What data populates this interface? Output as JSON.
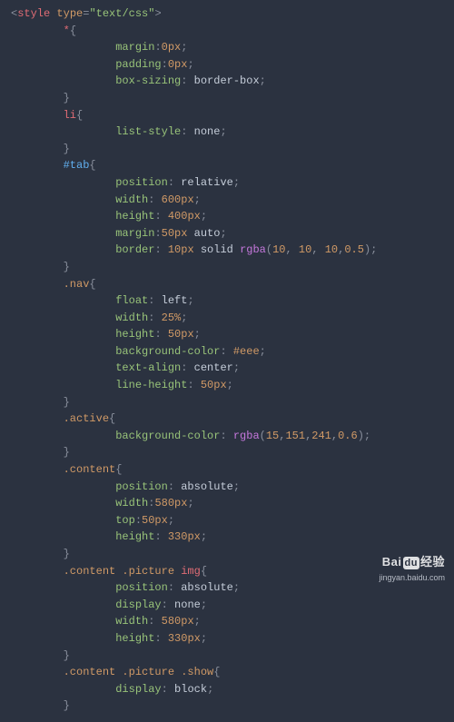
{
  "opening_tag": {
    "lt": "<",
    "name": "style",
    "sp": " ",
    "attr": "type",
    "eq": "=",
    "q1": "\"",
    "val": "text/css",
    "q2": "\"",
    "gt": ">"
  },
  "rules": [
    {
      "indent": "        ",
      "selector": {
        "text": "*",
        "cls": "sel-univ"
      },
      "brace_indent": "        ",
      "prop_indent": "                ",
      "decls": [
        {
          "prop": "margin",
          "sep": ":",
          "parts": [
            {
              "t": "0px",
              "c": "num"
            }
          ]
        },
        {
          "prop": "padding",
          "sep": ":",
          "parts": [
            {
              "t": "0px",
              "c": "num"
            }
          ]
        },
        {
          "prop": "box-sizing",
          "sep": ": ",
          "parts": [
            {
              "t": "border-box",
              "c": "val"
            }
          ]
        }
      ]
    },
    {
      "indent": "        ",
      "selector": {
        "text": "li",
        "cls": "sel-el"
      },
      "brace_indent": "        ",
      "prop_indent": "                ",
      "decls": [
        {
          "prop": "list-style",
          "sep": ": ",
          "parts": [
            {
              "t": "none",
              "c": "val"
            }
          ]
        }
      ]
    },
    {
      "indent": "        ",
      "selector": {
        "text": "#tab",
        "cls": "sel-id"
      },
      "brace_indent": "        ",
      "prop_indent": "                ",
      "decls": [
        {
          "prop": "position",
          "sep": ": ",
          "parts": [
            {
              "t": "relative",
              "c": "val"
            }
          ]
        },
        {
          "prop": "width",
          "sep": ": ",
          "parts": [
            {
              "t": "600px",
              "c": "num"
            }
          ]
        },
        {
          "prop": "height",
          "sep": ": ",
          "parts": [
            {
              "t": "400px",
              "c": "num"
            }
          ]
        },
        {
          "prop": "margin",
          "sep": ":",
          "parts": [
            {
              "t": "50px",
              "c": "num"
            },
            {
              "t": " ",
              "c": "pn"
            },
            {
              "t": "auto",
              "c": "val"
            }
          ]
        },
        {
          "prop": "border",
          "sep": ": ",
          "parts": [
            {
              "t": "10px",
              "c": "num"
            },
            {
              "t": " ",
              "c": "pn"
            },
            {
              "t": "solid",
              "c": "val"
            },
            {
              "t": " ",
              "c": "pn"
            },
            {
              "t": "rgba",
              "c": "fn"
            },
            {
              "t": "(",
              "c": "pn"
            },
            {
              "t": "10",
              "c": "num"
            },
            {
              "t": ", ",
              "c": "pn"
            },
            {
              "t": "10",
              "c": "num"
            },
            {
              "t": ", ",
              "c": "pn"
            },
            {
              "t": "10",
              "c": "num"
            },
            {
              "t": ",",
              "c": "pn"
            },
            {
              "t": "0.5",
              "c": "num"
            },
            {
              "t": ")",
              "c": "pn"
            }
          ]
        }
      ]
    },
    {
      "indent": "        ",
      "selector": {
        "text": ".nav",
        "cls": "sel-cls"
      },
      "brace_indent": "        ",
      "prop_indent": "                ",
      "decls": [
        {
          "prop": "float",
          "sep": ": ",
          "parts": [
            {
              "t": "left",
              "c": "val"
            }
          ]
        },
        {
          "prop": "width",
          "sep": ": ",
          "parts": [
            {
              "t": "25%",
              "c": "num"
            }
          ]
        },
        {
          "prop": "height",
          "sep": ": ",
          "parts": [
            {
              "t": "50px",
              "c": "num"
            }
          ]
        },
        {
          "prop": "background-color",
          "sep": ": ",
          "parts": [
            {
              "t": "#eee",
              "c": "hex"
            }
          ]
        },
        {
          "prop": "text-align",
          "sep": ": ",
          "parts": [
            {
              "t": "center",
              "c": "val"
            }
          ]
        },
        {
          "prop": "line-height",
          "sep": ": ",
          "parts": [
            {
              "t": "50px",
              "c": "num"
            }
          ]
        }
      ]
    },
    {
      "indent": "        ",
      "selector": {
        "text": ".active",
        "cls": "sel-cls"
      },
      "brace_indent": "        ",
      "prop_indent": "                ",
      "decls": [
        {
          "prop": "background-color",
          "sep": ": ",
          "parts": [
            {
              "t": "rgba",
              "c": "fn"
            },
            {
              "t": "(",
              "c": "pn"
            },
            {
              "t": "15",
              "c": "num"
            },
            {
              "t": ",",
              "c": "pn"
            },
            {
              "t": "151",
              "c": "num"
            },
            {
              "t": ",",
              "c": "pn"
            },
            {
              "t": "241",
              "c": "num"
            },
            {
              "t": ",",
              "c": "pn"
            },
            {
              "t": "0.6",
              "c": "num"
            },
            {
              "t": ")",
              "c": "pn"
            }
          ]
        }
      ]
    },
    {
      "indent": "        ",
      "selector": {
        "text": ".content",
        "cls": "sel-cls"
      },
      "brace_indent": "        ",
      "prop_indent": "                ",
      "decls": [
        {
          "prop": "position",
          "sep": ": ",
          "parts": [
            {
              "t": "absolute",
              "c": "val"
            }
          ]
        },
        {
          "prop": "width",
          "sep": ":",
          "parts": [
            {
              "t": "580px",
              "c": "num"
            }
          ]
        },
        {
          "prop": "top",
          "sep": ":",
          "parts": [
            {
              "t": "50px",
              "c": "num"
            }
          ]
        },
        {
          "prop": "height",
          "sep": ": ",
          "parts": [
            {
              "t": "330px",
              "c": "num"
            }
          ]
        }
      ]
    },
    {
      "indent": "        ",
      "selector_multi": [
        {
          "text": ".content",
          "cls": "sel-cls"
        },
        {
          "text": " ",
          "cls": "pn"
        },
        {
          "text": ".picture",
          "cls": "sel-cls"
        },
        {
          "text": " ",
          "cls": "pn"
        },
        {
          "text": "img",
          "cls": "sel-el"
        }
      ],
      "brace_indent": "        ",
      "prop_indent": "                ",
      "decls": [
        {
          "prop": "position",
          "sep": ": ",
          "parts": [
            {
              "t": "absolute",
              "c": "val"
            }
          ]
        },
        {
          "prop": "display",
          "sep": ": ",
          "parts": [
            {
              "t": "none",
              "c": "val"
            }
          ]
        },
        {
          "prop": "width",
          "sep": ": ",
          "parts": [
            {
              "t": "580px",
              "c": "num"
            }
          ]
        },
        {
          "prop": "height",
          "sep": ": ",
          "parts": [
            {
              "t": "330px",
              "c": "num"
            }
          ]
        }
      ]
    },
    {
      "indent": "        ",
      "selector_multi": [
        {
          "text": ".content",
          "cls": "sel-cls"
        },
        {
          "text": " ",
          "cls": "pn"
        },
        {
          "text": ".picture",
          "cls": "sel-cls"
        },
        {
          "text": " ",
          "cls": "pn"
        },
        {
          "text": ".show",
          "cls": "sel-cls"
        }
      ],
      "brace_indent": "        ",
      "prop_indent": "                ",
      "decls": [
        {
          "prop": "display",
          "sep": ": ",
          "parts": [
            {
              "t": "block",
              "c": "val"
            }
          ]
        }
      ]
    }
  ],
  "watermark": {
    "brand_a": "Bai",
    "brand_b": "du",
    "brand_c": "经验",
    "url": "jingyan.baidu.com"
  }
}
